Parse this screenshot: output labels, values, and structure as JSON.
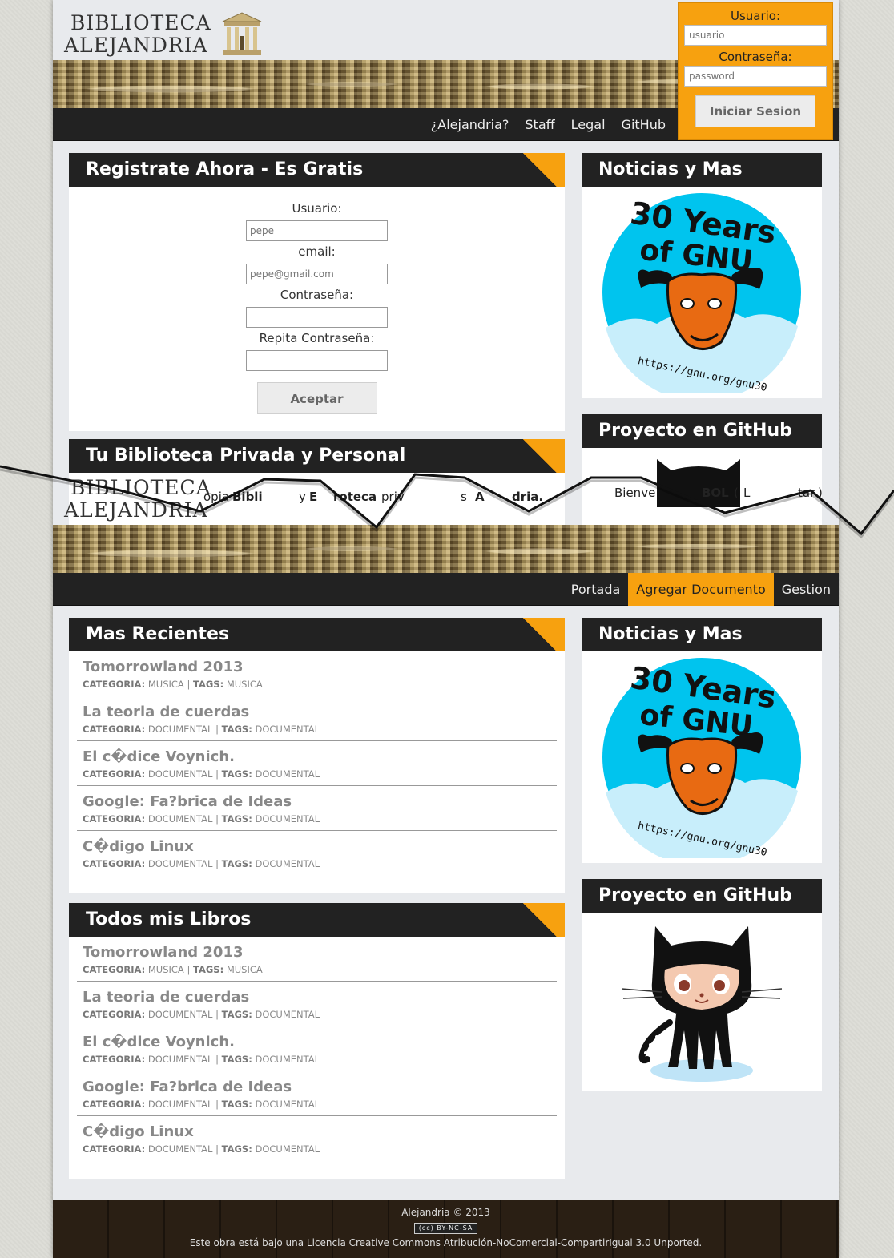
{
  "logo": {
    "line1": "BIBLIOTECA",
    "line2": "ALEJANDRIA"
  },
  "top": {
    "nav": [
      "¿Alejandria?",
      "Staff",
      "Legal",
      "GitHub"
    ],
    "login": {
      "user_label": "Usuario:",
      "user_placeholder": "usuario",
      "pass_label": "Contraseña:",
      "pass_placeholder": "password",
      "button": "Iniciar Sesion"
    },
    "register": {
      "title": "Registrate Ahora - Es Gratis",
      "user_label": "Usuario:",
      "user_placeholder": "pepe",
      "email_label": "email:",
      "email_placeholder": "pepe@gmail.com",
      "pass_label": "Contraseña:",
      "pass2_label": "Repita Contraseña:",
      "button": "Aceptar"
    },
    "private_title": "Tu Biblioteca Privada y Personal",
    "private_fragments": [
      "opia",
      "Bibli",
      "y",
      "E",
      "roteca",
      "priv",
      "s",
      "A",
      "dria."
    ],
    "news_title": "Noticias y Mas",
    "github_title": "Proyecto en GitHub",
    "github_fragments": [
      "Bienve",
      "BOL",
      "(",
      "L",
      "tar",
      ")"
    ]
  },
  "bottom": {
    "nav": [
      "Portada",
      "Agregar Documento",
      "Gestion"
    ],
    "active_nav": "Agregar Documento",
    "recent_title": "Mas Recientes",
    "books_title": "Todos mis Libros",
    "news_title": "Noticias y Mas",
    "github_title": "Proyecto en GitHub",
    "meta_labels": {
      "category": "CATEGORIA:",
      "sep": "|",
      "tags": "TAGS:"
    },
    "recent": [
      {
        "title": "Tomorrowland 2013",
        "category": "MUSICA",
        "tags": "MUSICA"
      },
      {
        "title": "La teoria de cuerdas",
        "category": "DOCUMENTAL",
        "tags": "DOCUMENTAL"
      },
      {
        "title": "El c�dice Voynich.",
        "category": "DOCUMENTAL",
        "tags": "DOCUMENTAL"
      },
      {
        "title": "Google: Fa?brica de Ideas",
        "category": "DOCUMENTAL",
        "tags": "DOCUMENTAL"
      },
      {
        "title": "C�digo Linux",
        "category": "DOCUMENTAL",
        "tags": "DOCUMENTAL"
      }
    ],
    "books": [
      {
        "title": "Tomorrowland 2013",
        "category": "MUSICA",
        "tags": "MUSICA"
      },
      {
        "title": "La teoria de cuerdas",
        "category": "DOCUMENTAL",
        "tags": "DOCUMENTAL"
      },
      {
        "title": "El c�dice Voynich.",
        "category": "DOCUMENTAL",
        "tags": "DOCUMENTAL"
      },
      {
        "title": "Google: Fa?brica de Ideas",
        "category": "DOCUMENTAL",
        "tags": "DOCUMENTAL"
      },
      {
        "title": "C�digo Linux",
        "category": "DOCUMENTAL",
        "tags": "DOCUMENTAL"
      }
    ]
  },
  "gnu_badge": {
    "line1": "30 Years",
    "line2": "of GNU",
    "url": "https://gnu.org/gnu30"
  },
  "footer": {
    "copyright": "Alejandria © 2013",
    "cc_badge": "BY-NC-SA",
    "license": "Este obra está bajo una Licencia Creative Commons Atribución-NoComercial-CompartirIgual 3.0 Unported."
  },
  "colors": {
    "accent": "#f7a10f",
    "dark": "#222222",
    "panel_bg": "#e8eaed"
  }
}
